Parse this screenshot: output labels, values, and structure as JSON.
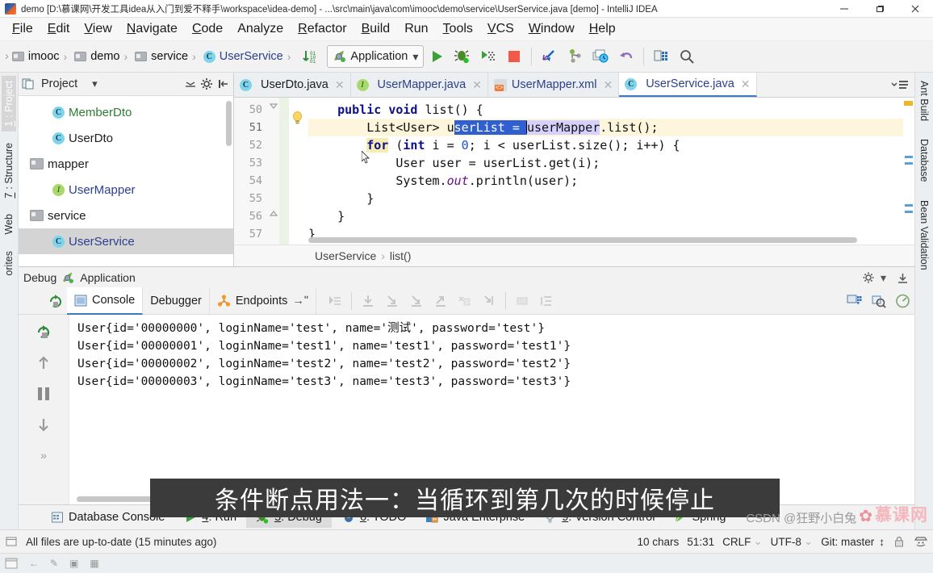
{
  "window": {
    "title": "demo [D:\\慕课网\\开发工具idea从入门到爱不释手\\workspace\\idea-demo] - ...\\src\\main\\java\\com\\imooc\\demo\\service\\UserService.java [demo] - IntelliJ IDEA",
    "minimize": "—",
    "maximize": "❐",
    "close": "✕"
  },
  "menu": {
    "items": [
      {
        "first": "F",
        "rest": "ile"
      },
      {
        "first": "E",
        "rest": "dit"
      },
      {
        "first": "V",
        "rest": "iew"
      },
      {
        "first": "N",
        "rest": "avigate"
      },
      {
        "first": "C",
        "rest": "ode"
      },
      {
        "first": "A",
        "rest": "nalyze"
      },
      {
        "first": "R",
        "rest": "efactor"
      },
      {
        "first": "B",
        "rest": "uild"
      },
      {
        "first": "R",
        "rest": "un"
      },
      {
        "first": "T",
        "rest": "ools"
      },
      {
        "first": "V",
        "rest": "CS"
      },
      {
        "first": "W",
        "rest": "indow"
      },
      {
        "first": "H",
        "rest": "elp"
      }
    ]
  },
  "navbar": {
    "crumbs": [
      {
        "label": "imooc",
        "icon": "folder-icon",
        "color": "dark"
      },
      {
        "label": "demo",
        "icon": "folder-icon",
        "color": "dark"
      },
      {
        "label": "service",
        "icon": "folder-icon",
        "color": "dark"
      },
      {
        "label": "UserService",
        "icon": "class-icon",
        "color": "blue"
      }
    ],
    "separator": "›",
    "run_config": "Application",
    "run_config_caret": "⌄",
    "buttons": [
      "run-button",
      "debug-button",
      "run-coverage-button",
      "stop-button",
      "update-project-button",
      "commit-button",
      "history-button",
      "undo-button",
      "project-structure-button",
      "search-everywhere-button"
    ]
  },
  "left_stripe": {
    "items": [
      {
        "label_num": "1",
        "label": ": Project",
        "selected": true
      },
      {
        "label_num": "7",
        "label": ": Structure",
        "selected": false
      },
      {
        "label_num": "",
        "label": "Web",
        "selected": false
      },
      {
        "label_num": "",
        "label": "orites",
        "selected": false
      }
    ]
  },
  "right_stripe": {
    "items": [
      "Ant Build",
      "Database",
      "Bean Validation"
    ]
  },
  "project_panel": {
    "title": "Project",
    "caret": "▾",
    "tree": [
      {
        "label": "MemberDto",
        "icon": "class-icon",
        "indent": 2,
        "color": "green",
        "selected": false
      },
      {
        "label": "UserDto",
        "icon": "class-icon",
        "indent": 2,
        "color": "dark",
        "selected": false
      },
      {
        "label": "mapper",
        "icon": "folder-icon",
        "indent": 1,
        "color": "dark",
        "selected": false
      },
      {
        "label": "UserMapper",
        "icon": "interface-icon",
        "indent": 2,
        "color": "blue",
        "selected": false
      },
      {
        "label": "service",
        "icon": "folder-icon",
        "indent": 1,
        "color": "dark",
        "selected": false
      },
      {
        "label": "UserService",
        "icon": "class-icon",
        "indent": 2,
        "color": "blue",
        "selected": true
      }
    ]
  },
  "editor": {
    "tabs": [
      {
        "label": "UserDto.java",
        "icon": "class-icon",
        "active": false,
        "close": "✕",
        "color": "dark"
      },
      {
        "label": "UserMapper.java",
        "icon": "interface-icon",
        "active": false,
        "close": "✕",
        "color": "blue"
      },
      {
        "label": "UserMapper.xml",
        "icon": "xml-icon",
        "active": false,
        "close": "✕",
        "color": "blue"
      },
      {
        "label": "UserService.java",
        "icon": "class-icon",
        "active": true,
        "close": "✕",
        "color": "blue"
      }
    ],
    "line_numbers": [
      "50",
      "51",
      "52",
      "53",
      "54",
      "55",
      "56",
      "57"
    ],
    "current_line": "51",
    "code_lines": [
      "    public void list() {",
      "        List<User> userList = userMapper.list();",
      "        for (int i = 0; i < userList.size(); i++) {",
      "            User user = userList.get(i);",
      "            System.out.println(user);",
      "        }",
      "    }",
      "}"
    ],
    "selection_text": "serList = ",
    "breadcrumb": [
      "UserService",
      "list()"
    ],
    "breadcrumb_sep": "›"
  },
  "debug_panel": {
    "window_title": "Debug",
    "config_name": "Application",
    "tabs": [
      {
        "label": "Console",
        "icon": "console-icon",
        "active": true
      },
      {
        "label": "Debugger",
        "icon": "",
        "active": false
      },
      {
        "label": "Endpoints",
        "icon": "endpoints-icon",
        "active": false
      }
    ],
    "endpoints_arrow": "→ʺ",
    "console_output": [
      "User{id='00000000', loginName='test', name='测试', password='test'}",
      "User{id='00000001', loginName='test1', name='test1', password='test1'}",
      "User{id='00000002', loginName='test2', name='test2', password='test2'}",
      "User{id='00000003', loginName='test3', name='test3', password='test3'}"
    ]
  },
  "bottom_bar": {
    "items": [
      {
        "num": "",
        "label": "Database Console",
        "icon": "database-console-icon",
        "active": false
      },
      {
        "num": "4",
        "label": ": Run",
        "icon": "run-icon",
        "active": false
      },
      {
        "num": "5",
        "label": ": Debug",
        "icon": "debug-icon",
        "active": true
      },
      {
        "num": "6",
        "label": ": TODO",
        "icon": "todo-icon",
        "active": false
      },
      {
        "num": "",
        "label": "Java Enterprise",
        "icon": "java-enterprise-icon",
        "active": false
      },
      {
        "num": "9",
        "label": ": Version Control",
        "icon": "version-control-icon",
        "active": false
      },
      {
        "num": "",
        "label": "Spring",
        "icon": "spring-icon",
        "active": false
      }
    ]
  },
  "status_bar": {
    "message": "All files are up-to-date (15 minutes ago)",
    "chars": "10 chars",
    "position": "51:31",
    "line_sep": "CRLF",
    "encoding": "UTF-8",
    "branch": "Git: master",
    "updown": "↕",
    "caret": "⌄"
  },
  "caption": {
    "text": "条件断点用法一：当循环到第几次的时候停止"
  },
  "watermark": {
    "csdn": "CSDN @狂野小白兔",
    "cn": "慕课网"
  },
  "colors": {
    "accent": "#3e7ac4",
    "selection": "#2f5fd0",
    "keyword": "#0f0f8c",
    "string": "#2e7d32",
    "caption_bg": "#3b3b3b"
  }
}
